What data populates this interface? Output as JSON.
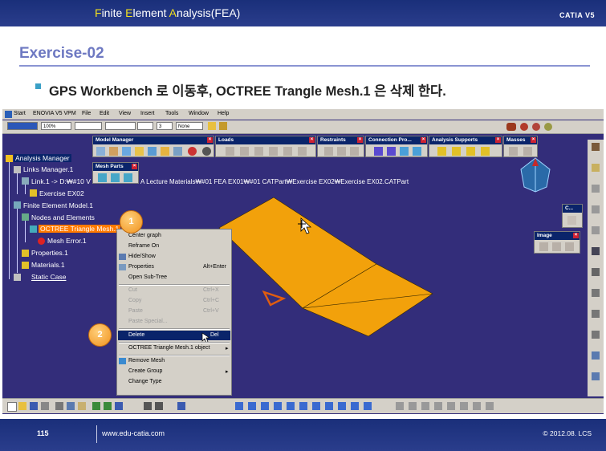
{
  "slide": {
    "header_title_parts": [
      "F",
      "inite ",
      "E",
      "lement ",
      "A",
      "nalysis(FEA)"
    ],
    "header_brand": "CATIA V5",
    "exercise_title": "Exercise-02",
    "instruction": "GPS Workbench 로 이동후, OCTREE Trangle Mesh.1 은 삭제 한다.",
    "page_number": "115",
    "url": "www.edu-catia.com",
    "copyright": "© 2012.08. LCS"
  },
  "menubar": {
    "items": [
      "Start",
      "ENOVIA V5 VPM",
      "File",
      "Edit",
      "View",
      "Insert",
      "Tools",
      "Window",
      "Help"
    ]
  },
  "standard_toolbar": {
    "zoom": "100%",
    "selection_mode": "None",
    "number": "3"
  },
  "toolbars": [
    {
      "title": "Model Manager"
    },
    {
      "title": "Loads"
    },
    {
      "title": "Restraints"
    },
    {
      "title": "Connection Pro..."
    },
    {
      "title": "Analysis Supports"
    },
    {
      "title": "Masses"
    },
    {
      "title": "Mesh Parts"
    },
    {
      "title": "C..."
    },
    {
      "title": "Image"
    }
  ],
  "path_text": "A Lecture Materials₩#01 FEA EX01₩#01 CATPart₩Exercise EX02₩Exercise EX02.CATPart",
  "tree": {
    "analysis_manager": "Analysis Manager",
    "links_manager": "Links Manager.1",
    "link": "Link.1 -> D:₩#10 V",
    "exercise": "Exercise EX02",
    "fe_model": "Finite Element Model.1",
    "nodes": "Nodes and Elements",
    "octree": "OCTREE Triangle Mesh.1",
    "mesh_error": "Mesh Error.1",
    "properties": "Properties.1",
    "materials": "Materials.1",
    "static_case": "Static Case"
  },
  "context_menu": {
    "items": [
      {
        "label": "Center graph",
        "shortcut": "",
        "disabled": false
      },
      {
        "label": "Reframe On",
        "shortcut": "",
        "disabled": false
      },
      {
        "label": "Hide/Show",
        "shortcut": "",
        "disabled": false
      },
      {
        "label": "Properties",
        "shortcut": "Alt+Enter",
        "disabled": false
      },
      {
        "label": "Open Sub-Tree",
        "shortcut": "",
        "disabled": false
      },
      {
        "label": "Cut",
        "shortcut": "Ctrl+X",
        "disabled": true
      },
      {
        "label": "Copy",
        "shortcut": "Ctrl+C",
        "disabled": true
      },
      {
        "label": "Paste",
        "shortcut": "Ctrl+V",
        "disabled": true
      },
      {
        "label": "Paste Special...",
        "shortcut": "",
        "disabled": true
      },
      {
        "label": "Delete",
        "shortcut": "Del",
        "disabled": false
      },
      {
        "label": "OCTREE Triangle Mesh.1 object",
        "shortcut": "",
        "disabled": false
      },
      {
        "label": "Remove Mesh",
        "shortcut": "",
        "disabled": false
      },
      {
        "label": "Create Group",
        "shortcut": "",
        "disabled": false
      },
      {
        "label": "Change Type",
        "shortcut": "",
        "disabled": false
      }
    ]
  },
  "callouts": [
    "1",
    "2"
  ],
  "colors": {
    "slide_header": "#1f3380",
    "catia_background": "#332d7a",
    "part_fill": "#f2a10b",
    "selection_blue": "#0a246a",
    "callout_orange": "#f0921e",
    "accent_title": "#6e79c2"
  }
}
